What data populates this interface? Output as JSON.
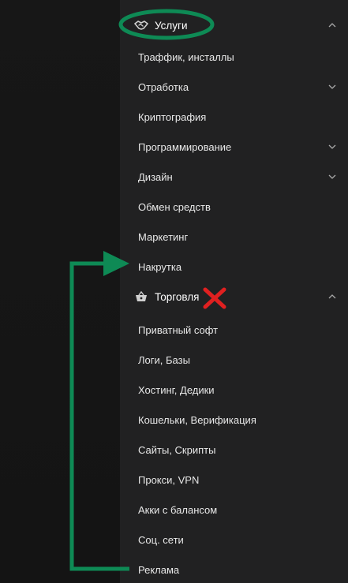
{
  "menu": {
    "groups": [
      {
        "label": "Услуги",
        "icon": "handshake-icon",
        "expanded": true,
        "items": [
          {
            "label": "Траффик, инсталлы",
            "has_submenu": false
          },
          {
            "label": "Отработка",
            "has_submenu": true
          },
          {
            "label": "Криптография",
            "has_submenu": false
          },
          {
            "label": "Программирование",
            "has_submenu": true
          },
          {
            "label": "Дизайн",
            "has_submenu": true
          },
          {
            "label": "Обмен средств",
            "has_submenu": false
          },
          {
            "label": "Маркетинг",
            "has_submenu": false
          },
          {
            "label": "Накрутка",
            "has_submenu": false
          }
        ]
      },
      {
        "label": "Торговля",
        "icon": "basket-icon",
        "expanded": true,
        "items": [
          {
            "label": "Приватный софт",
            "has_submenu": false
          },
          {
            "label": "Логи, Базы",
            "has_submenu": false
          },
          {
            "label": "Хостинг, Дедики",
            "has_submenu": false
          },
          {
            "label": "Кошельки, Верификация",
            "has_submenu": false
          },
          {
            "label": "Сайты, Скрипты",
            "has_submenu": false
          },
          {
            "label": "Прокси, VPN",
            "has_submenu": false
          },
          {
            "label": "Акки с балансом",
            "has_submenu": false
          },
          {
            "label": "Соц. сети",
            "has_submenu": false
          },
          {
            "label": "Реклама",
            "has_submenu": false
          }
        ]
      }
    ]
  },
  "annotations": {
    "highlight_color": "#0e8a55",
    "cross_color": "#e02020"
  },
  "colors": {
    "menu_bg": "#212122",
    "text": "#e8e8e8",
    "chevron": "#a8a8a8"
  }
}
